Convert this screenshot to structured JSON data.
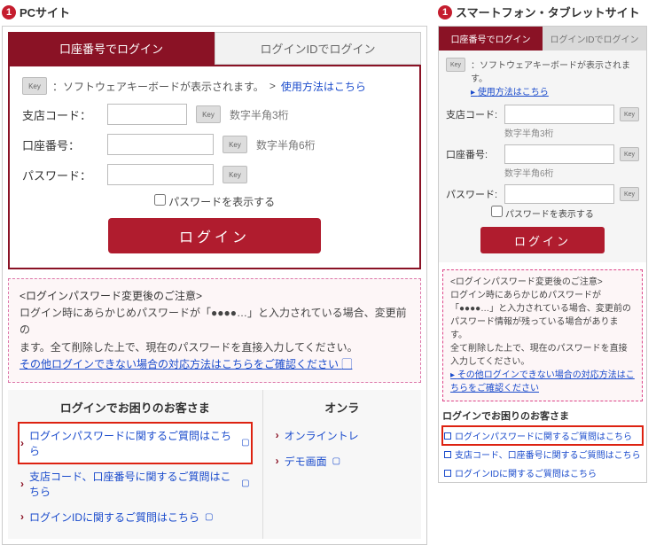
{
  "pc": {
    "section_title": "PCサイト",
    "tabs": {
      "acct": "口座番号でログイン",
      "id": "ログインIDでログイン"
    },
    "kb_hint": "：ソフトウェアキーボードが表示されます。",
    "kb_link_prefix": "> ",
    "kb_link": "使用方法はこちら",
    "fields": {
      "branch": {
        "label": "支店コード：",
        "hint": "数字半角3桁"
      },
      "acct": {
        "label": "口座番号：",
        "hint": "数字半角6桁"
      },
      "pw": {
        "label": "パスワード："
      }
    },
    "show_pw": "パスワードを表示する",
    "login_btn": "ログイン",
    "notice": {
      "title": "<ログインパスワード変更後のご注意>",
      "line1": "ログイン時にあらかじめパスワードが「●●●●…」と入力されている場合、変更前の",
      "line2": "ます。全て削除した上で、現在のパスワードを直接入力してください。",
      "link": "その他ログインできない場合の対応方法はこちらをご確認ください"
    },
    "help": {
      "left_head": "ログインでお困りのお客さま",
      "right_head": "オンラ",
      "items_left": [
        "ログインパスワードに関するご質問はこちら",
        "支店コード、口座番号に関するご質問はこちら",
        "ログインIDに関するご質問はこちら"
      ],
      "items_right": [
        "オンライントレ",
        "デモ画面"
      ]
    }
  },
  "sp": {
    "section_title": "スマートフォン・タブレットサイト",
    "tabs": {
      "acct": "口座番号でログイン",
      "id": "ログインIDでログイン"
    },
    "kb_hint": "：ソフトウェアキーボードが表示されます。",
    "kb_link": "使用方法はこちら",
    "fields": {
      "branch": {
        "label": "支店コード:",
        "hint": "数字半角3桁"
      },
      "acct": {
        "label": "口座番号:",
        "hint": "数字半角6桁"
      },
      "pw": {
        "label": "パスワード:"
      }
    },
    "show_pw": "パスワードを表示する",
    "login_btn": "ログイン",
    "notice": {
      "title": "<ログインパスワード変更後のご注意>",
      "body": "ログイン時にあらかじめパスワードが「●●●●…」と入力されている場合、変更前のパスワード情報が残っている場合があります。\n全て削除した上で、現在のパスワードを直接入力してください。",
      "link": "その他ログインできない場合の対応方法はこちらをご確認ください"
    },
    "help": {
      "head": "ログインでお困りのお客さま",
      "items": [
        "ログインパスワードに関するご質問はこちら",
        "支店コード、口座番号に関するご質問はこちら",
        "ログインIDに関するご質問はこちら"
      ]
    }
  },
  "badge_num": "1"
}
